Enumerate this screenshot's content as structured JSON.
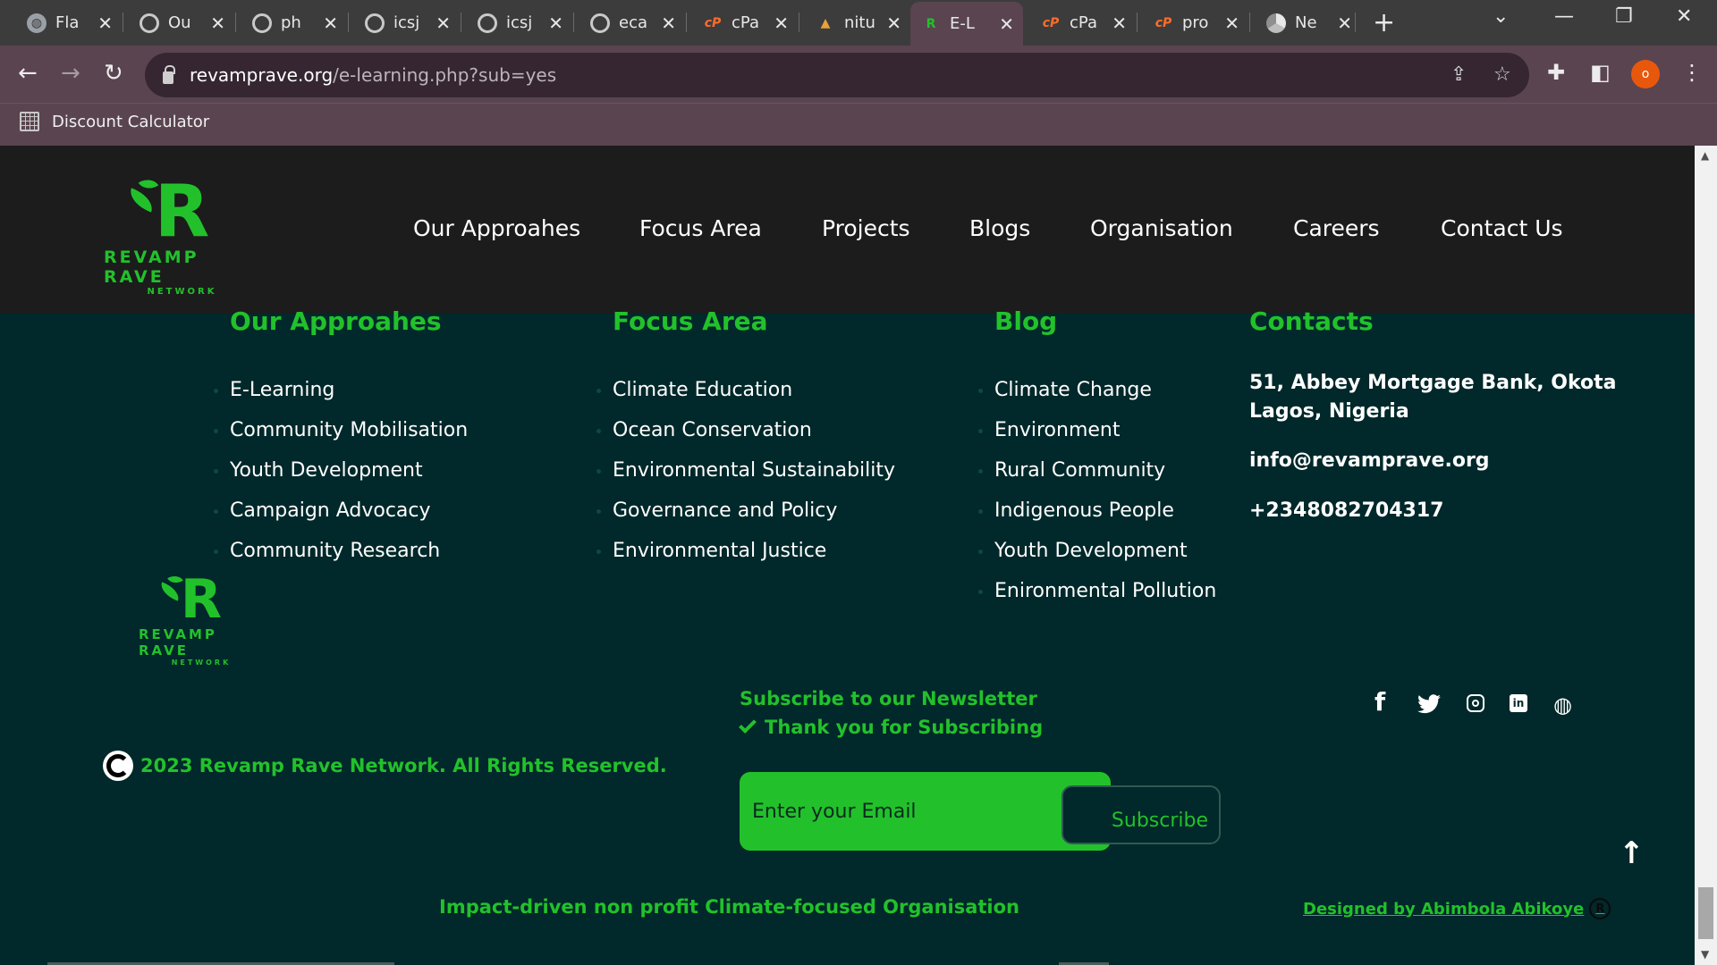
{
  "browser": {
    "tabs": [
      {
        "title": "Fla",
        "icon": "globe-icon"
      },
      {
        "title": "Ou",
        "icon": "ring-icon"
      },
      {
        "title": "ph",
        "icon": "ring-icon"
      },
      {
        "title": "icsj",
        "icon": "ring-icon"
      },
      {
        "title": "icsj",
        "icon": "ring-icon"
      },
      {
        "title": "eca",
        "icon": "ring-icon"
      },
      {
        "title": "cPa",
        "icon": "cpanel-icon"
      },
      {
        "title": "nitu",
        "icon": "mountain-icon"
      },
      {
        "title": "E-L",
        "icon": "revamp-icon",
        "active": true
      },
      {
        "title": "cPa",
        "icon": "cpanel-icon"
      },
      {
        "title": "pro",
        "icon": "cpanel-icon"
      },
      {
        "title": "Ne",
        "icon": "chrome-icon"
      }
    ],
    "url_host": "revamprave.org",
    "url_path": "/e-learning.php?sub=yes",
    "profile_letter": "o",
    "bookmark": "Discount Calculator"
  },
  "site": {
    "brand": "REVAMP RAVE",
    "brand_sub": "NETWORK",
    "nav": [
      "Our Approahes",
      "Focus Area",
      "Projects",
      "Blogs",
      "Organisation",
      "Careers",
      "Contact Us"
    ],
    "columns": {
      "approaches": {
        "title": "Our Approahes",
        "items": [
          "E-Learning",
          "Community Mobilisation",
          "Youth Development",
          "Campaign Advocacy",
          "Community Research"
        ]
      },
      "focus": {
        "title": "Focus Area",
        "items": [
          "Climate Education",
          "Ocean Conservation",
          "Environmental Sustainability",
          "Governance and Policy",
          "Environmental Justice"
        ]
      },
      "blog": {
        "title": "Blog",
        "items": [
          "Climate Change",
          "Environment",
          "Rural Community",
          "Indigenous People",
          "Youth Development",
          "Enironmental Pollution"
        ]
      },
      "contacts": {
        "title": "Contacts",
        "address_line1": "51, Abbey Mortgage Bank, Okota",
        "address_line2": "Lagos, Nigeria",
        "email": "info@revamprave.org",
        "phone": "+2348082704317"
      }
    },
    "newsletter": {
      "title": "Subscribe to our Newsletter",
      "thanks": "Thank you for Subscribing",
      "placeholder": "Enter your Email",
      "button": "Subscribe"
    },
    "copyright": "2023 Revamp Rave Network. All Rights Reserved.",
    "tagline": "Impact-driven non profit Climate-focused Organisation",
    "designer": "Designed by Abimbola Abikoye",
    "social": [
      "facebook-icon",
      "twitter-icon",
      "instagram-icon",
      "linkedin-icon",
      "website-icon"
    ],
    "colors": {
      "accent": "#22c12b",
      "footer_bg": "#01282a",
      "header_bg": "#1c1c1c"
    }
  }
}
